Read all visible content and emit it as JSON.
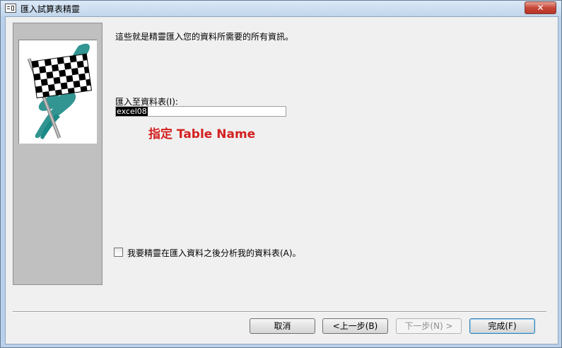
{
  "window": {
    "title": "匯入試算表精靈",
    "close_label": "✕"
  },
  "main": {
    "info_text": "這些就是精靈匯入您的資料所需要的所有資訊。",
    "table_label": "匯入至資料表(I):",
    "table_value": "excel08",
    "annotation": "指定 Table Name",
    "analyze_label": "我要精靈在匯入資料之後分析我的資料表(A)。",
    "analyze_checked": false
  },
  "buttons": {
    "cancel": "取消",
    "back": "<上一步(B)",
    "next": "下一步(N) >",
    "finish": "完成(F)"
  },
  "colors": {
    "annotation": "#d42020",
    "flag_teal": "#1c8a86"
  }
}
